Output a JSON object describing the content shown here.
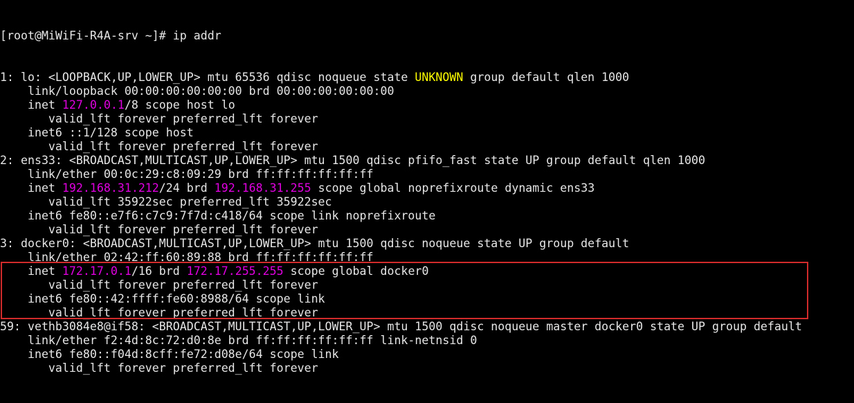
{
  "terminal": {
    "prompt": "[root@MiWiFi-R4A-srv ~]# ",
    "command": "ip addr",
    "colors": {
      "background": "#000000",
      "text": "#e6e6e6",
      "address_highlight": "#e000e0",
      "state_unknown": "#ffff00",
      "selection_box": "#d12b2b"
    },
    "lines": [
      {
        "segments": [
          {
            "text": "1: lo: <LOOPBACK,UP,LOWER_UP> mtu 65536 qdisc noqueue state "
          },
          {
            "text": "UNKNOWN",
            "color": "yellow"
          },
          {
            "text": " group default qlen 1000"
          }
        ]
      },
      {
        "segments": [
          {
            "text": "    link/loopback 00:00:00:00:00:00 brd 00:00:00:00:00:00"
          }
        ]
      },
      {
        "segments": [
          {
            "text": "    inet "
          },
          {
            "text": "127.0.0.1",
            "color": "magenta"
          },
          {
            "text": "/8 scope host lo"
          }
        ]
      },
      {
        "segments": [
          {
            "text": "       valid_lft forever preferred_lft forever"
          }
        ]
      },
      {
        "segments": [
          {
            "text": "    inet6 ::1/128 scope host"
          }
        ]
      },
      {
        "segments": [
          {
            "text": "       valid_lft forever preferred_lft forever"
          }
        ]
      },
      {
        "segments": [
          {
            "text": "2: ens33: <BROADCAST,MULTICAST,UP,LOWER_UP> mtu 1500 qdisc pfifo_fast state UP group default qlen 1000"
          }
        ]
      },
      {
        "segments": [
          {
            "text": "    link/ether 00:0c:29:c8:09:29 brd ff:ff:ff:ff:ff:ff"
          }
        ]
      },
      {
        "segments": [
          {
            "text": "    inet "
          },
          {
            "text": "192.168.31.212",
            "color": "magenta"
          },
          {
            "text": "/24 brd "
          },
          {
            "text": "192.168.31.255",
            "color": "magenta"
          },
          {
            "text": " scope global noprefixroute dynamic ens33"
          }
        ]
      },
      {
        "segments": [
          {
            "text": "       valid_lft 35922sec preferred_lft 35922sec"
          }
        ]
      },
      {
        "segments": [
          {
            "text": "    inet6 fe80::e7f6:c7c9:7f7d:c418/64 scope link noprefixroute"
          }
        ]
      },
      {
        "segments": [
          {
            "text": "       valid_lft forever preferred_lft forever"
          }
        ]
      },
      {
        "segments": [
          {
            "text": "3: docker0: <BROADCAST,MULTICAST,UP,LOWER_UP> mtu 1500 qdisc noqueue state UP group default"
          }
        ]
      },
      {
        "segments": [
          {
            "text": "    link/ether 02:42:ff:60:89:88 brd ff:ff:ff:ff:ff:ff"
          }
        ]
      },
      {
        "segments": [
          {
            "text": "    inet "
          },
          {
            "text": "172.17.0.1",
            "color": "magenta"
          },
          {
            "text": "/16 brd "
          },
          {
            "text": "172.17.255.255",
            "color": "magenta"
          },
          {
            "text": " scope global docker0"
          }
        ]
      },
      {
        "segments": [
          {
            "text": "       valid_lft forever preferred_lft forever"
          }
        ]
      },
      {
        "segments": [
          {
            "text": "    inet6 fe80::42:ffff:fe60:8988/64 scope link"
          }
        ]
      },
      {
        "segments": [
          {
            "text": "       valid_lft forever preferred_lft forever"
          }
        ]
      },
      {
        "segments": [
          {
            "text": "59: vethb3084e8@if58: <BROADCAST,MULTICAST,UP,LOWER_UP> mtu 1500 qdisc noqueue master docker0 state UP group default"
          }
        ]
      },
      {
        "segments": [
          {
            "text": "    link/ether f2:4d:8c:72:d0:8e brd ff:ff:ff:ff:ff:ff link-netnsid 0"
          }
        ]
      },
      {
        "segments": [
          {
            "text": "    inet6 fe80::f04d:8cff:fe72:d08e/64 scope link"
          }
        ]
      },
      {
        "segments": [
          {
            "text": "       valid_lft forever preferred_lft forever"
          }
        ]
      }
    ]
  }
}
